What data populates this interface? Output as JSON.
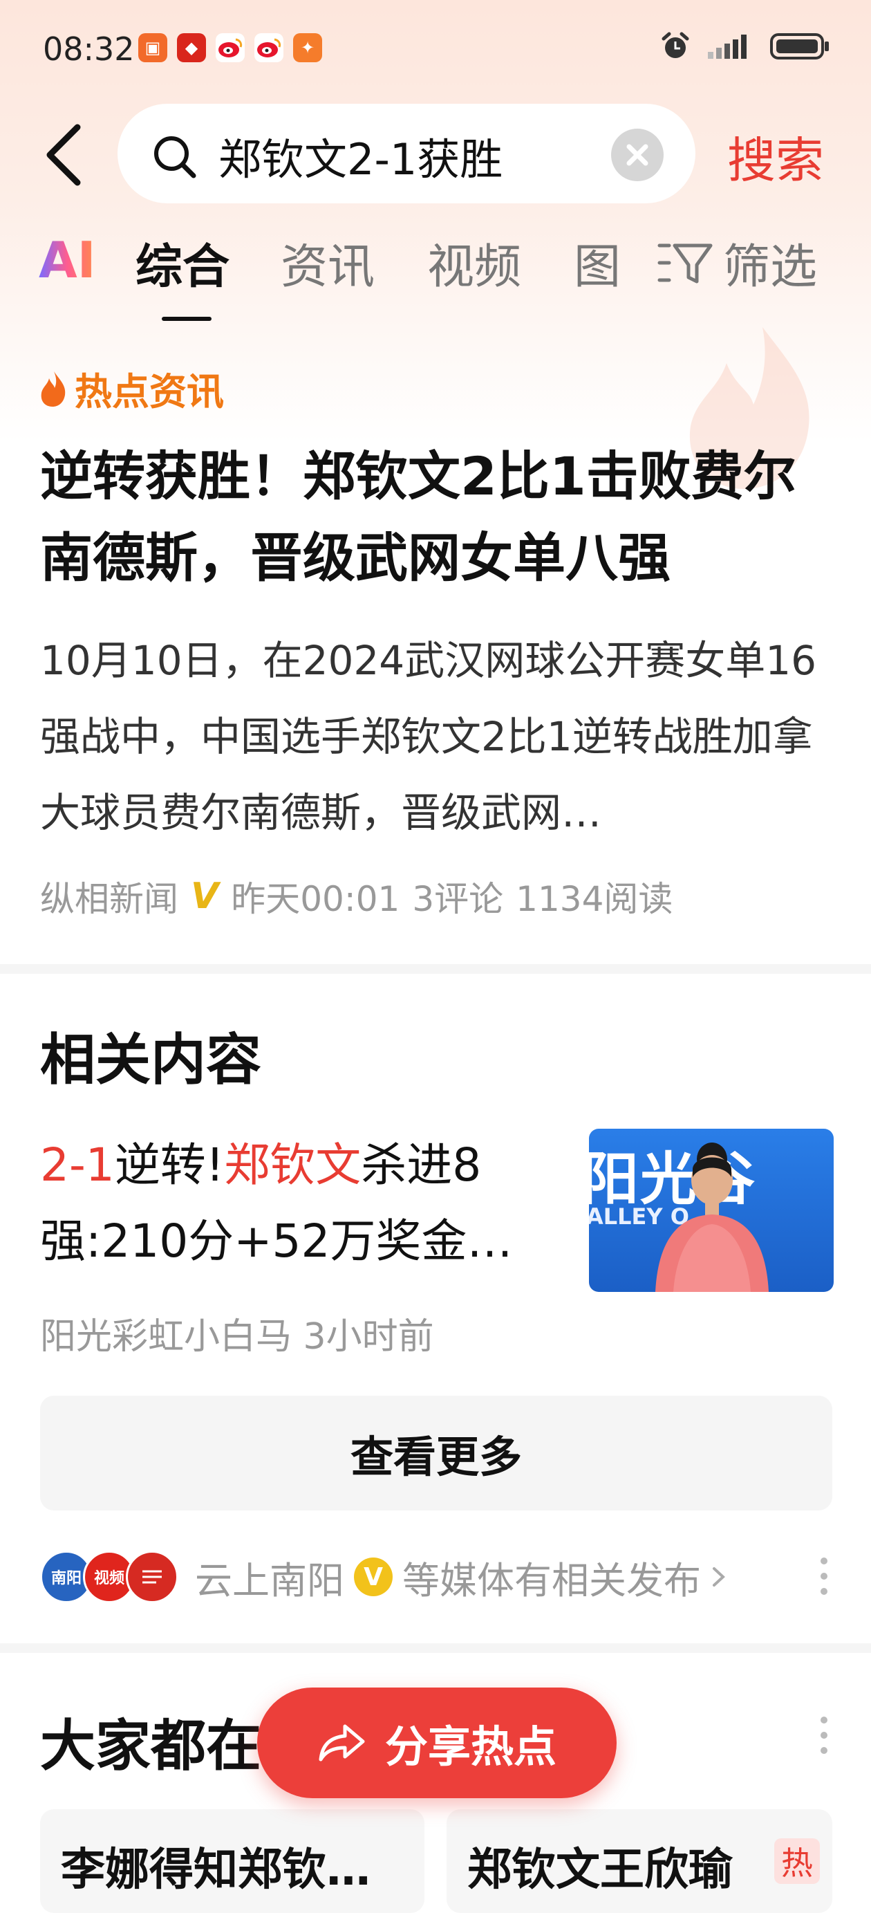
{
  "status_bar": {
    "time": "08:32"
  },
  "search": {
    "query": "郑钦文2-1获胜",
    "search_label": "搜索"
  },
  "tabs": [
    {
      "label": "AI"
    },
    {
      "label": "综合"
    },
    {
      "label": "资讯"
    },
    {
      "label": "视频"
    },
    {
      "label": "图"
    },
    {
      "label": "筛选"
    }
  ],
  "hot_news": {
    "section_label": "热点资讯",
    "headline": "逆转获胜！郑钦文2比1击败费尔南德斯，晋级武网女单八强",
    "summary": "10月10日，在2024武汉网球公开赛女单16强战中，中国选手郑钦文2比1逆转战胜加拿大球员费尔南德斯，晋级武网…",
    "source": "纵相新闻",
    "verified_mark": "V",
    "time": "昨天00:01",
    "comments": "3评论",
    "reads": "1134阅读"
  },
  "related": {
    "title": "相关内容",
    "item": {
      "title_part1": "2-1",
      "title_part2": "逆转!",
      "title_part3": "郑钦文",
      "title_part4": "杀进8强:210分+52万奖金…",
      "source": "阳光彩虹小白马 3小时前",
      "thumb_banner_text": "阳光谷",
      "thumb_banner_sub": "ALLEY O"
    },
    "more_label": "查看更多",
    "media_source": "云上南阳",
    "media_suffix": "等媒体有相关发布",
    "media_verified_mark": "V",
    "media_logo_1": "南阳",
    "media_logo_2": "视频"
  },
  "everyone_section": {
    "title": "大家都在搜",
    "cards": [
      {
        "text": "李娜得知郑钦…"
      },
      {
        "text": "郑钦文王欣瑜",
        "tag": "热"
      }
    ]
  },
  "share_button": {
    "label": "分享热点"
  },
  "colors": {
    "accent_red": "#e83c32",
    "hot_orange": "#f07814",
    "verified_yellow": "#f2c21b"
  }
}
